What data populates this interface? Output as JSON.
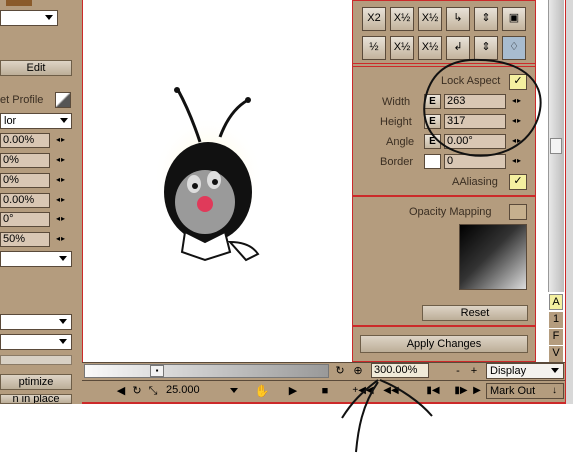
{
  "left_panel": {
    "edit_label": "Edit",
    "profile_label": "et Profile",
    "color_dropdown": "lor",
    "values": [
      "0.00%",
      "0%",
      "0%",
      "0.00%",
      "0°",
      "50%"
    ],
    "optimize_label": "ptimize",
    "in_place_label": "n in place"
  },
  "toolbar": {
    "row1": [
      "X2",
      "X½",
      "X½",
      "↳",
      "⇕",
      "▣"
    ],
    "row2": [
      "½",
      "X½",
      "X½",
      "↲",
      "⇕",
      "♢"
    ]
  },
  "properties": {
    "lock_aspect_label": "Lock Aspect",
    "lock_aspect_check": "✓",
    "width_label": "Width",
    "width_value": "263",
    "height_label": "Height",
    "height_value": "317",
    "angle_label": "Angle",
    "angle_value": "0.00°",
    "border_label": "Border",
    "border_value": "0",
    "e_label": "E",
    "aaliasing_label": "AAliasing",
    "aaliasing_check": "✓",
    "opacity_label": "Opacity Mapping",
    "reset_label": "Reset",
    "apply_label": "Apply Changes"
  },
  "side_letters": [
    "A",
    "1",
    "F",
    "V"
  ],
  "viewer": {
    "zoom_value": "300.00%",
    "minus_label": "-",
    "plus_label": "+",
    "display_label": "Display"
  },
  "transport": {
    "fps_value": "25.000",
    "mark_out_label": "Mark Out"
  },
  "colors": {
    "panel_tan": "#b49c7e",
    "annotation_red": "#d01e1e",
    "field_bg": "#d9c7b4"
  }
}
